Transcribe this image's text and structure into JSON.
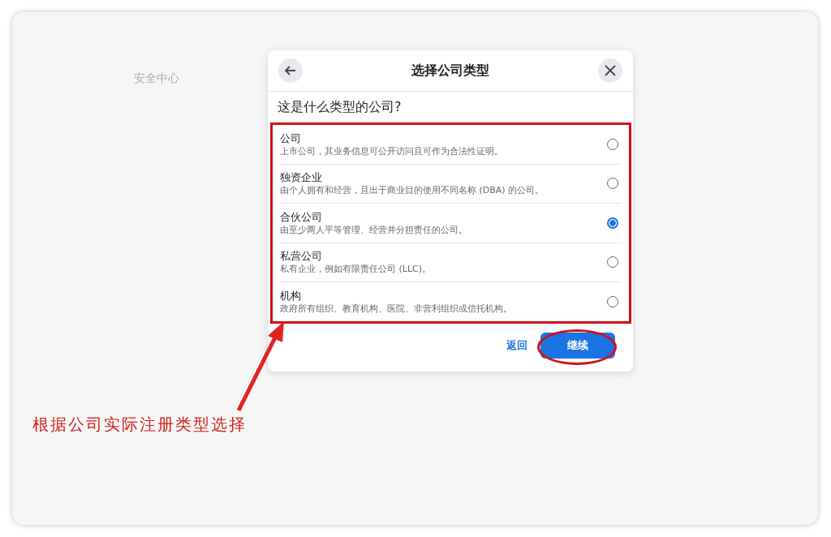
{
  "background": {
    "heading": "安全中心"
  },
  "dialog": {
    "title": "选择公司类型",
    "question": "这是什么类型的公司?",
    "options": [
      {
        "label": "公司",
        "description": "上市公司，其业务信息可公开访问且可作为合法性证明。",
        "selected": false
      },
      {
        "label": "独资企业",
        "description": "由个人拥有和经营，且出于商业目的使用不同名称 (DBA) 的公司。",
        "selected": false
      },
      {
        "label": "合伙公司",
        "description": "由至少两人平等管理、经营并分担责任的公司。",
        "selected": true
      },
      {
        "label": "私营公司",
        "description": "私有企业，例如有限责任公司 (LLC)。",
        "selected": false
      },
      {
        "label": "机构",
        "description": "政府所有组织、教育机构、医院、非营利组织或信托机构。",
        "selected": false
      }
    ],
    "back_link": "返回",
    "continue_button": "继续"
  },
  "annotation": {
    "caption": "根据公司实际注册类型选择"
  }
}
